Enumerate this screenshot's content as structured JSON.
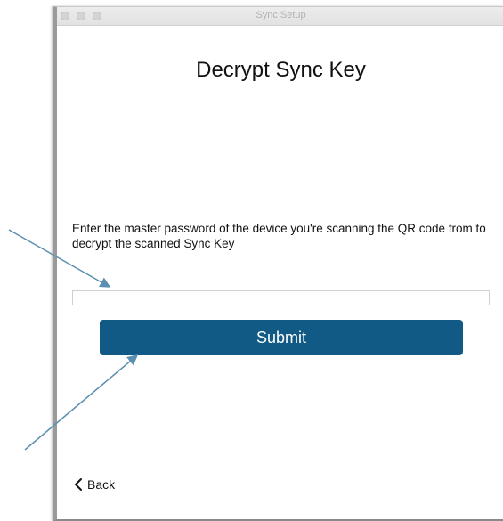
{
  "window": {
    "title": "Sync Setup"
  },
  "page": {
    "heading": "Decrypt Sync Key",
    "instructions": "Enter the master password of the device you're scanning the QR code from to decrypt the scanned Sync Key"
  },
  "form": {
    "password_value": "",
    "password_placeholder": "",
    "submit_label": "Submit"
  },
  "nav": {
    "back_label": "Back",
    "back_icon": "chevron-left-icon"
  },
  "colors": {
    "submit_bg": "#115a85",
    "annotation_arrow": "#5b8fb0"
  }
}
